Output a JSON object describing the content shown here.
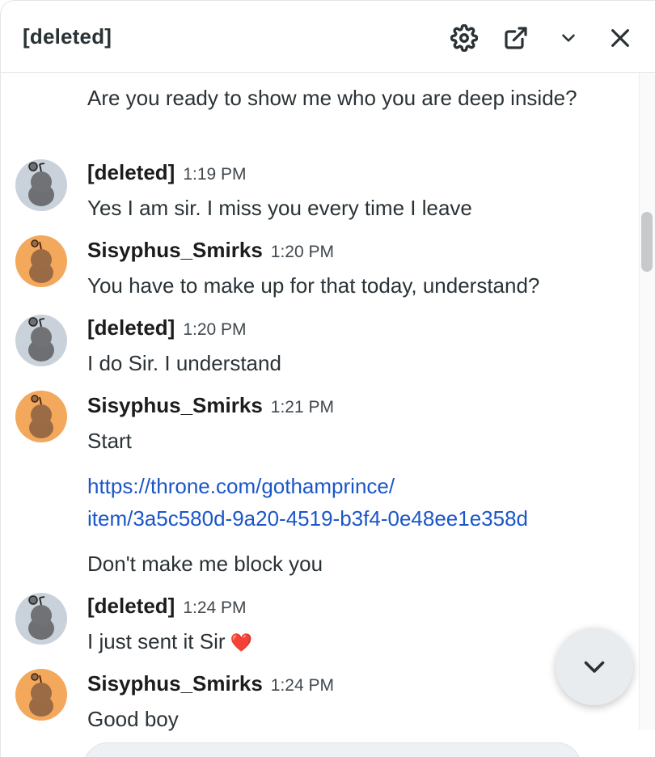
{
  "header": {
    "title": "[deleted]",
    "icons": [
      "gear-icon",
      "external-link-icon",
      "chevron-down-icon",
      "close-icon"
    ]
  },
  "messages": [
    {
      "type": "text",
      "text": "Are you ready to show me who you are deep inside?"
    },
    {
      "type": "message",
      "author": "[deleted]",
      "time": "1:19 PM",
      "avatar": "gray",
      "text": "Yes I am sir. I miss you every time I leave"
    },
    {
      "type": "message",
      "author": "Sisyphus_Smirks",
      "time": "1:20 PM",
      "avatar": "orange",
      "text": "You have to make up for that today, understand?"
    },
    {
      "type": "message",
      "author": "[deleted]",
      "time": "1:20 PM",
      "avatar": "gray",
      "text": "I do Sir. I understand"
    },
    {
      "type": "message",
      "author": "Sisyphus_Smirks",
      "time": "1:21 PM",
      "avatar": "orange",
      "text": "Start"
    },
    {
      "type": "link",
      "line1": "https://throne.com/gothamprince/",
      "line2": "item/3a5c580d-9a20-4519-b3f4-0e48ee1e358d"
    },
    {
      "type": "text",
      "text": "Don't make me block you"
    },
    {
      "type": "message",
      "author": "[deleted]",
      "time": "1:24 PM",
      "avatar": "gray",
      "text": "I just sent it Sir",
      "emoji": "❤️"
    },
    {
      "type": "message",
      "author": "Sisyphus_Smirks",
      "time": "1:24 PM",
      "avatar": "orange",
      "text": "Good boy"
    }
  ],
  "colors": {
    "link": "#1a56c9",
    "avatar_gray_bg": "#c9d2da",
    "avatar_orange_bg": "#f3a85c",
    "text": "#2a3236"
  }
}
